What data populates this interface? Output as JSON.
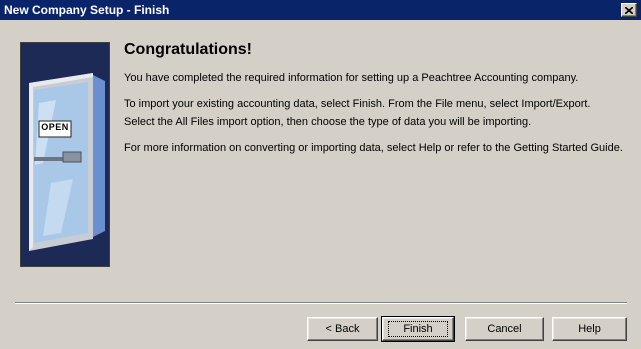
{
  "window": {
    "title": "New Company Setup - Finish"
  },
  "art": {
    "sign_text": "OPEN",
    "icon": "open-door-icon"
  },
  "content": {
    "heading": "Congratulations!",
    "paragraphs": [
      "You have completed the required information for setting up a Peachtree Accounting company.",
      "To import your existing accounting data, select Finish. From the File menu, select Import/Export. Select the All Files import option, then choose the type of data you will be importing.",
      "For more information on converting or importing data, select Help or refer to the Getting Started Guide."
    ]
  },
  "buttons": {
    "back": "< Back",
    "finish": "Finish",
    "cancel": "Cancel",
    "help": "Help"
  },
  "colors": {
    "titlebar": "#0a246a",
    "face": "#d4d0c8",
    "art_background": "#1c2a55",
    "glass": "#a9c8e8"
  }
}
